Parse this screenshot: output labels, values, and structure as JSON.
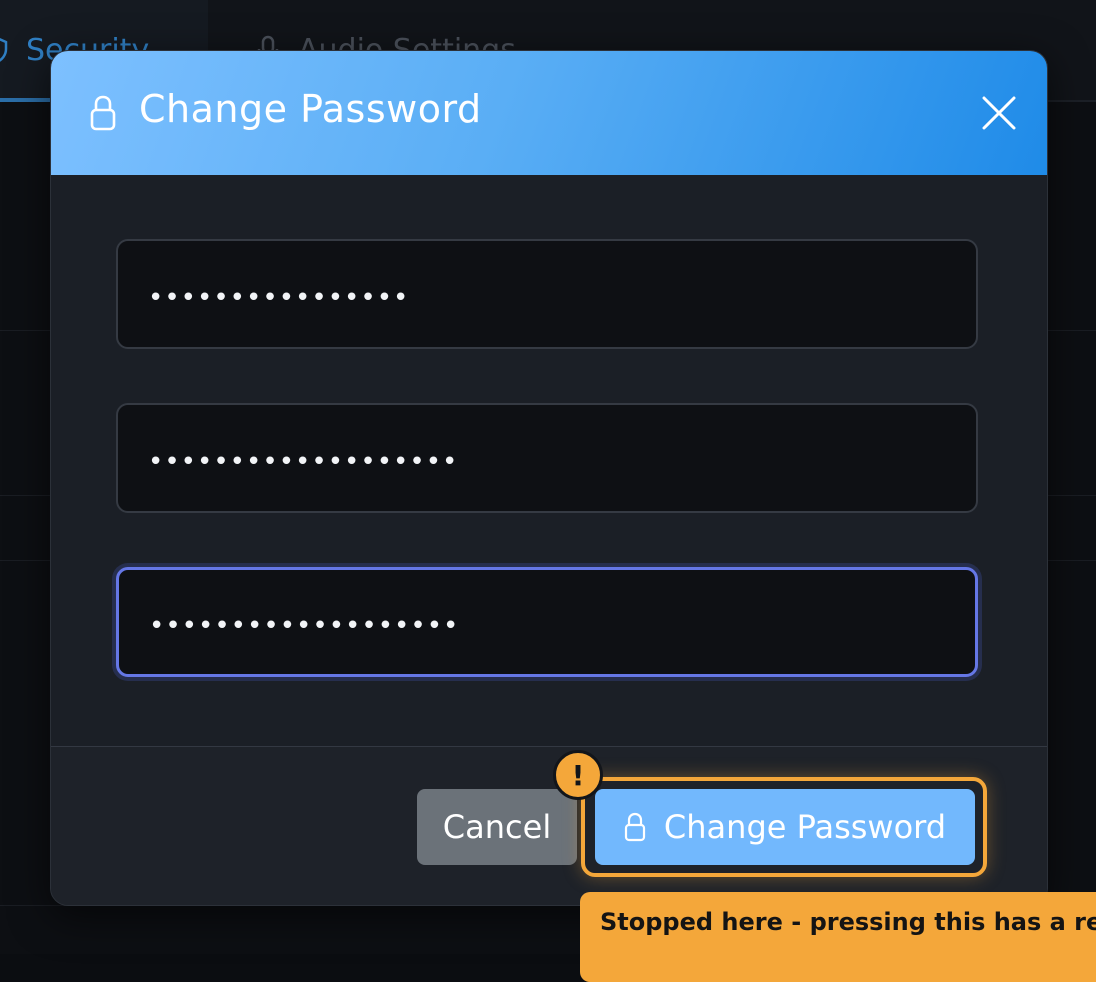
{
  "background": {
    "tabs": [
      {
        "label": "Security",
        "icon": "shield-icon",
        "active": true
      },
      {
        "label": "Audio Settings",
        "icon": "microphone-icon",
        "active": false
      }
    ]
  },
  "dialog": {
    "title": "Change Password",
    "title_icon": "lock-icon",
    "close_icon": "close-icon",
    "fields": [
      {
        "name": "current-password",
        "value": "••••••••••••••••"
      },
      {
        "name": "new-password",
        "value": "•••••••••••••••••••"
      },
      {
        "name": "confirm-password",
        "value": "•••••••••••••••••••",
        "focused": true
      }
    ],
    "cancel_label": "Cancel",
    "confirm_label": "Change Password",
    "confirm_icon": "lock-icon"
  },
  "warning": {
    "badge": "!",
    "message": "Stopped here - pressing this has a real-world effect"
  },
  "colors": {
    "header_gradient_start": "#7dc0ff",
    "header_gradient_end": "#1f8be8",
    "primary_button": "#72b8fd",
    "cancel_button": "#6b7279",
    "warning": "#f4a73a",
    "focus_ring": "#6577e6"
  }
}
